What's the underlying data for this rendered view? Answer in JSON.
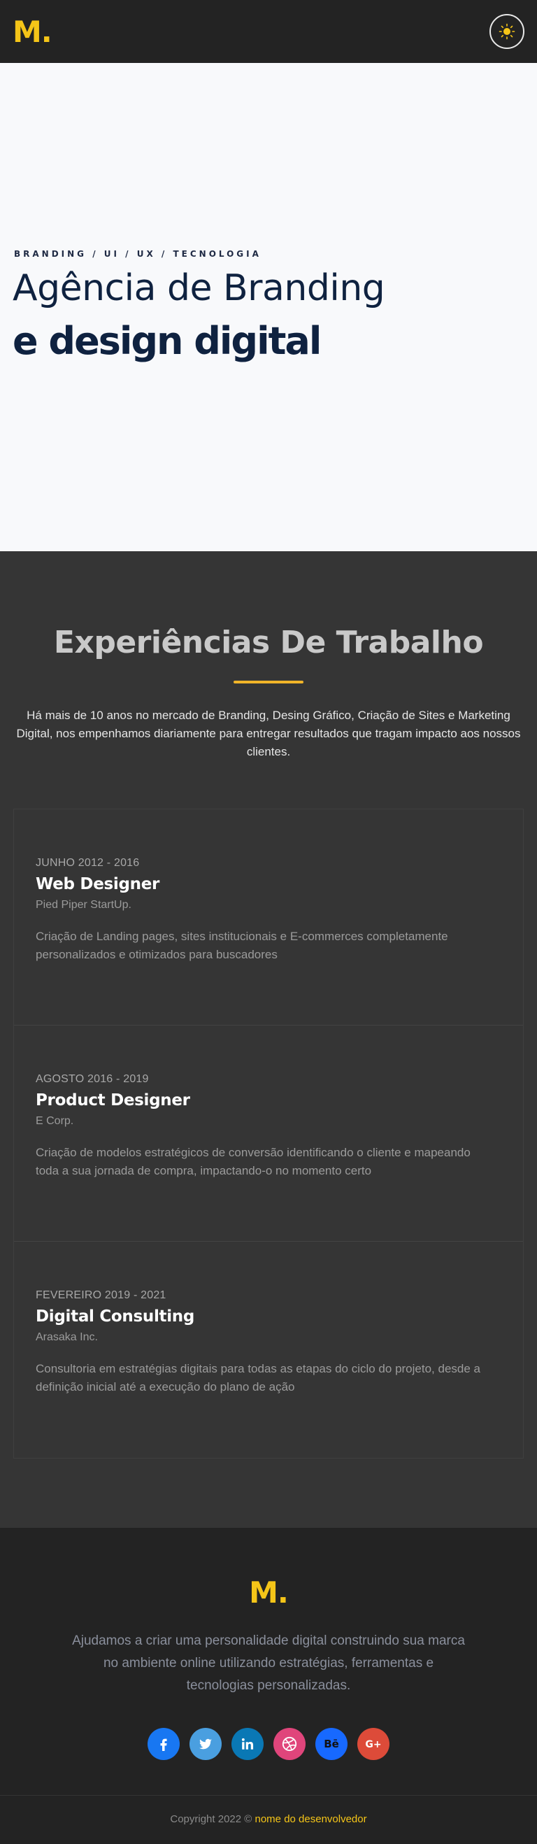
{
  "header": {
    "logo": "M.",
    "theme_toggle_icon": "sun-icon"
  },
  "hero": {
    "tags": "BRANDING / UI / UX / TECNOLOGIA",
    "title": "Agência de Branding",
    "subtitle": "e design digital"
  },
  "experience": {
    "title": "Experiências De Trabalho",
    "intro": "Há mais de 10 anos no mercado de Branding, Desing Gráfico, Criação de Sites e Marketing Digital, nos empenhamos diariamente para entregar resultados que tragam impacto aos nossos clientes.",
    "items": [
      {
        "date": "JUNHO 2012 - 2016",
        "role": "Web Designer",
        "company": "Pied Piper StartUp.",
        "description": "Criação de Landing pages, sites institucionais e E-commerces completamente personalizados e otimizados para buscadores"
      },
      {
        "date": "AGOSTO 2016 - 2019",
        "role": "Product Designer",
        "company": "E Corp.",
        "description": "Criação de modelos estratégicos de conversão identificando o cliente e mapeando toda a sua jornada de compra, impactando-o no momento certo"
      },
      {
        "date": "FEVEREIRO 2019 - 2021",
        "role": "Digital Consulting",
        "company": "Arasaka Inc.",
        "description": "Consultoria em estratégias digitais para todas as etapas do ciclo do projeto, desde a definição inicial até a execução do plano de ação"
      }
    ]
  },
  "footer": {
    "logo": "M.",
    "text": "Ajudamos a criar uma personalidade digital construindo sua marca no ambiente online utilizando estratégias, ferramentas e tecnologias personalizadas.",
    "socials": [
      {
        "name": "facebook-icon",
        "color": "#1877f2"
      },
      {
        "name": "twitter-icon",
        "color": "#4a9fe0"
      },
      {
        "name": "linkedin-icon",
        "color": "#0a78b5"
      },
      {
        "name": "dribbble-icon",
        "color": "#e0457b"
      },
      {
        "name": "behance-icon",
        "color": "#1769ff"
      },
      {
        "name": "google-plus-icon",
        "color": "#dd4b39"
      }
    ],
    "copyright_prefix": "Copyright 2022 ©",
    "copyright_link": "nome do desenvolvedor"
  },
  "colors": {
    "accent": "#f5c518",
    "underline": "#f0b429",
    "hero_text": "#0f2240"
  }
}
